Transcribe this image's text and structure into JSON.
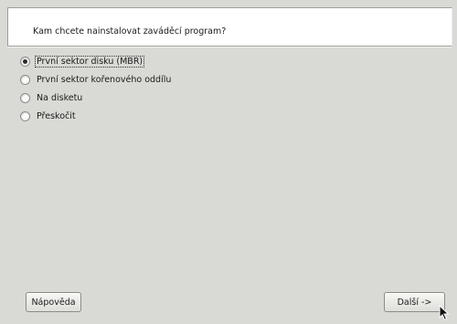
{
  "header": {
    "question": "Kam chcete nainstalovat zaváděcí program?"
  },
  "options": [
    {
      "label": "První sektor disku (MBR)",
      "checked": true
    },
    {
      "label": "První sektor kořenového oddílu",
      "checked": false
    },
    {
      "label": "Na disketu",
      "checked": false
    },
    {
      "label": "Přeskočit",
      "checked": false
    }
  ],
  "buttons": {
    "help_label": "Nápověda",
    "next_label": "Další ->"
  },
  "icons": {
    "pointer": "mouse-pointer-icon"
  }
}
